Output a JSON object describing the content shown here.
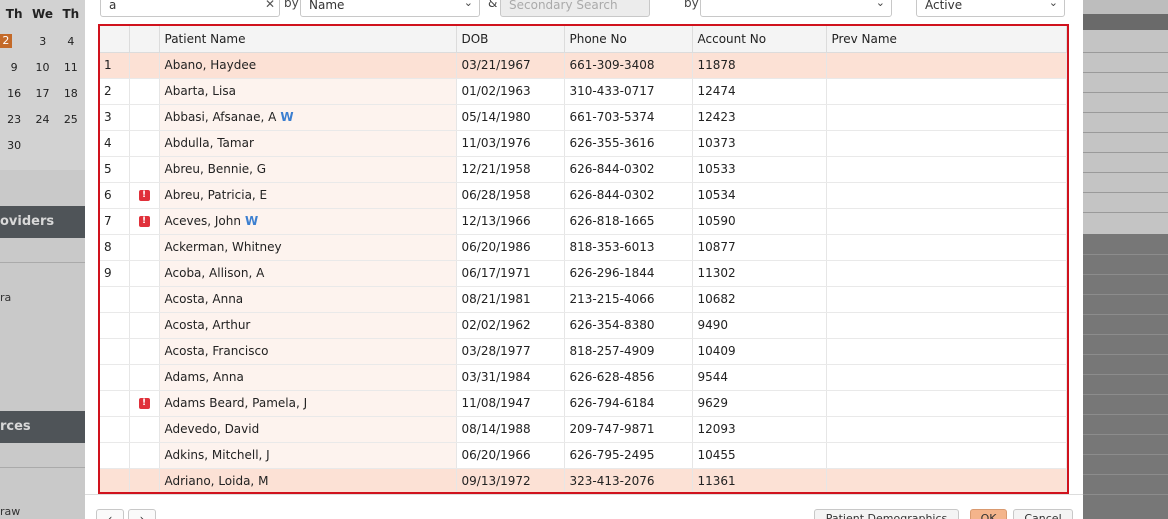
{
  "background": {
    "calendar": {
      "days": [
        "Th",
        "We",
        "Th"
      ],
      "rows": [
        [
          "2",
          "3",
          "4"
        ],
        [
          "9",
          "10",
          "11"
        ],
        [
          "16",
          "17",
          "18"
        ],
        [
          "23",
          "24",
          "25"
        ],
        [
          "30",
          "",
          ""
        ]
      ]
    },
    "providers_label": "oviders",
    "provider_item": "ra",
    "resources_label": "rces",
    "resource_item": "raw"
  },
  "search": {
    "query": "a",
    "by_label_1": "by",
    "field_1": "Name",
    "amp_label": "&",
    "secondary_placeholder": "Secondary Search",
    "by_label_2": "by",
    "field_2": "",
    "status": "Active"
  },
  "table": {
    "columns": [
      "",
      "",
      "Patient Name",
      "DOB",
      "Phone No",
      "Account No",
      "Prev Name"
    ],
    "rows": [
      {
        "num": "1",
        "flag": false,
        "name": "Abano, Haydee",
        "w": false,
        "dob": "03/21/1967",
        "phone": "661-309-3408",
        "account": "11878",
        "prev": "",
        "selected": true
      },
      {
        "num": "2",
        "flag": false,
        "name": "Abarta, Lisa",
        "w": false,
        "dob": "01/02/1963",
        "phone": "310-433-0717",
        "account": "12474",
        "prev": "",
        "selected": false
      },
      {
        "num": "3",
        "flag": false,
        "name": "Abbasi, Afsanae, A",
        "w": true,
        "dob": "05/14/1980",
        "phone": "661-703-5374",
        "account": "12423",
        "prev": "",
        "selected": false
      },
      {
        "num": "4",
        "flag": false,
        "name": "Abdulla, Tamar",
        "w": false,
        "dob": "11/03/1976",
        "phone": "626-355-3616",
        "account": "10373",
        "prev": "",
        "selected": false
      },
      {
        "num": "5",
        "flag": false,
        "name": "Abreu, Bennie, G",
        "w": false,
        "dob": "12/21/1958",
        "phone": "626-844-0302",
        "account": "10533",
        "prev": "",
        "selected": false
      },
      {
        "num": "6",
        "flag": true,
        "name": "Abreu, Patricia, E",
        "w": false,
        "dob": "06/28/1958",
        "phone": "626-844-0302",
        "account": "10534",
        "prev": "",
        "selected": false
      },
      {
        "num": "7",
        "flag": true,
        "name": "Aceves, John",
        "w": true,
        "dob": "12/13/1966",
        "phone": "626-818-1665",
        "account": "10590",
        "prev": "",
        "selected": false
      },
      {
        "num": "8",
        "flag": false,
        "name": "Ackerman, Whitney",
        "w": false,
        "dob": "06/20/1986",
        "phone": "818-353-6013",
        "account": "10877",
        "prev": "",
        "selected": false
      },
      {
        "num": "9",
        "flag": false,
        "name": "Acoba, Allison, A",
        "w": false,
        "dob": "06/17/1971",
        "phone": "626-296-1844",
        "account": "11302",
        "prev": "",
        "selected": false
      },
      {
        "num": "",
        "flag": false,
        "name": "Acosta, Anna",
        "w": false,
        "dob": "08/21/1981",
        "phone": "213-215-4066",
        "account": "10682",
        "prev": "",
        "selected": false
      },
      {
        "num": "",
        "flag": false,
        "name": "Acosta, Arthur",
        "w": false,
        "dob": "02/02/1962",
        "phone": "626-354-8380",
        "account": "9490",
        "prev": "",
        "selected": false
      },
      {
        "num": "",
        "flag": false,
        "name": "Acosta, Francisco",
        "w": false,
        "dob": "03/28/1977",
        "phone": "818-257-4909",
        "account": "10409",
        "prev": "",
        "selected": false
      },
      {
        "num": "",
        "flag": false,
        "name": "Adams, Anna",
        "w": false,
        "dob": "03/31/1984",
        "phone": "626-628-4856",
        "account": "9544",
        "prev": "",
        "selected": false
      },
      {
        "num": "",
        "flag": true,
        "name": "Adams Beard, Pamela, J",
        "w": false,
        "dob": "11/08/1947",
        "phone": "626-794-6184",
        "account": "9629",
        "prev": "",
        "selected": false
      },
      {
        "num": "",
        "flag": false,
        "name": "Adevedo, David",
        "w": false,
        "dob": "08/14/1988",
        "phone": "209-747-9871",
        "account": "12093",
        "prev": "",
        "selected": false
      },
      {
        "num": "",
        "flag": false,
        "name": "Adkins, Mitchell, J",
        "w": false,
        "dob": "06/20/1966",
        "phone": "626-795-2495",
        "account": "10455",
        "prev": "",
        "selected": false
      },
      {
        "num": "",
        "flag": false,
        "name": "Adriano, Loida, M",
        "w": false,
        "dob": "09/13/1972",
        "phone": "323-413-2076",
        "account": "11361",
        "prev": "",
        "selected": true
      }
    ],
    "w_marker": "W",
    "flag_glyph": "!"
  },
  "footer": {
    "prev_glyph": "‹",
    "next_glyph": "›",
    "demographics_label": "Patient Demographics",
    "ok_label": "OK",
    "cancel_label": "Cancel"
  }
}
